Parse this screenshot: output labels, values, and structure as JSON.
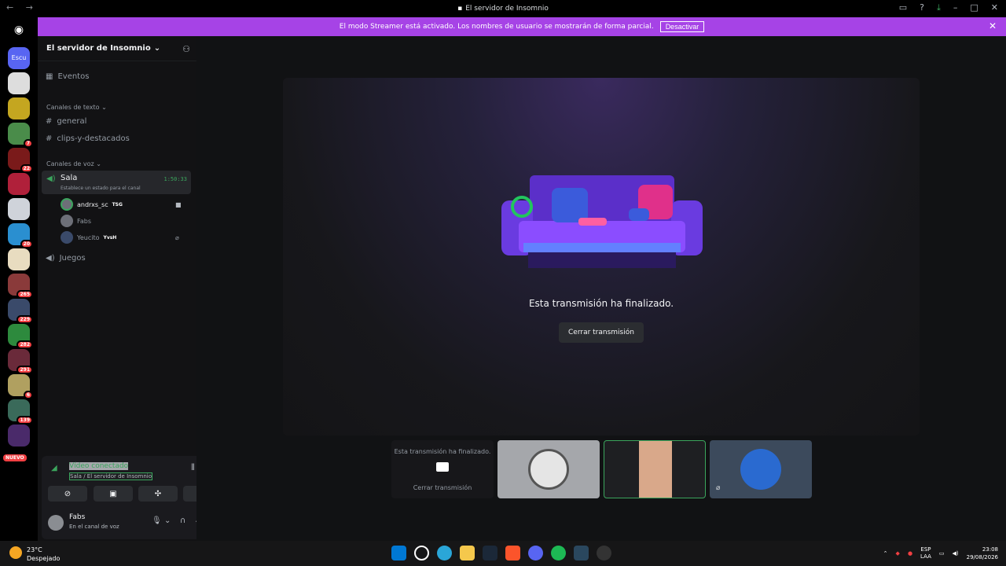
{
  "window": {
    "title": "El servidor de Insomnio",
    "back_icon": "←",
    "forward_icon": "→"
  },
  "banner": {
    "text": "El modo Streamer está activado. Los nombres de usuario se mostrarán de forma parcial.",
    "button": "Desactivar"
  },
  "servers": {
    "first_label": "Escu",
    "badges": [
      "7",
      "22",
      "20",
      "265",
      "229",
      "282",
      "291",
      "6",
      "139"
    ],
    "new_label": "NUEVO"
  },
  "sidebar": {
    "server_name": "El servidor de Insomnio",
    "events": "Eventos",
    "text_category": "Canales de texto",
    "text_channels": [
      "general",
      "clips-y-destacados"
    ],
    "voice_category": "Canales de voz",
    "active_voice": {
      "name": "Sala",
      "timer": "1:50:33",
      "status": "Establece un estado para el canal"
    },
    "voice_users": [
      {
        "name": "andrxs_sc",
        "tag": "TSG"
      },
      {
        "name": "Fabs",
        "tag": ""
      },
      {
        "name": "Yeucito",
        "tag": "YvsH"
      }
    ],
    "other_voice": "Juegos"
  },
  "voice_panel": {
    "status": "Vídeo conectado",
    "location": "Sala / El servidor de Insomnio"
  },
  "user": {
    "name": "Fabs",
    "status": "En el canal de voz"
  },
  "stage": {
    "ended_text": "Esta transmisión ha finalizado.",
    "close_button": "Cerrar transmisión"
  },
  "tiles": {
    "ended_label": "Esta transmisión ha finalizado.",
    "close_label": "Cerrar transmisión"
  },
  "taskbar": {
    "temperature": "23°C",
    "weather": "Despejado",
    "lang_top": "ESP",
    "lang_bottom": "LAA",
    "time": "23:08",
    "date": "29/08/2026"
  },
  "colors": {
    "banner": "#a643e6",
    "voice_green": "#3ba55d",
    "badge_red": "#f23f42"
  }
}
